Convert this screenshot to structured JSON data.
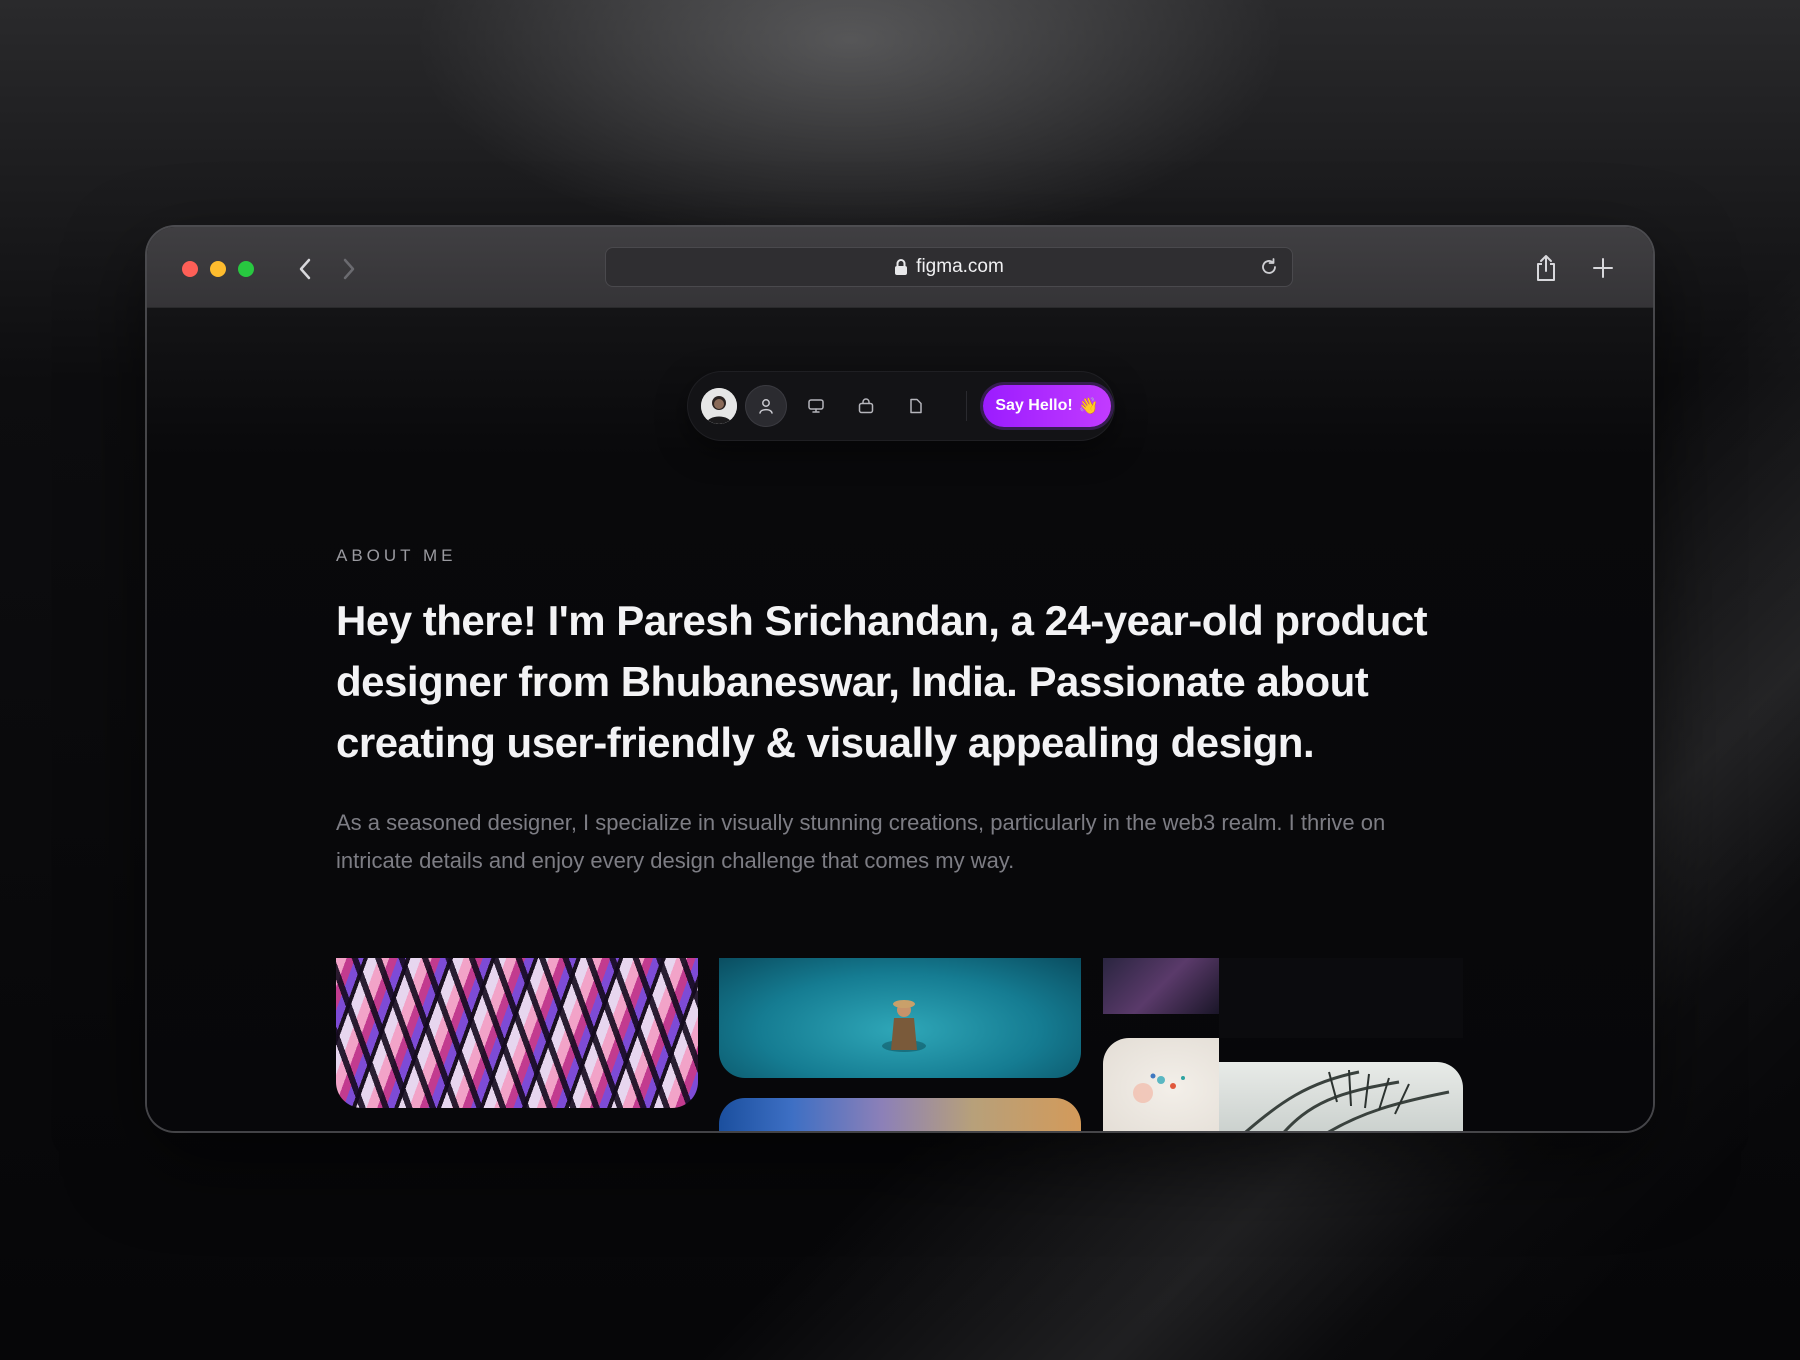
{
  "browser": {
    "url": "figma.com"
  },
  "nav": {
    "items": [
      "avatar",
      "about-person-icon",
      "projects-monitor-icon",
      "work-bag-icon",
      "resume-document-icon"
    ],
    "cta_label": "Say Hello!",
    "cta_emoji": "👋",
    "accent": "#a32bff"
  },
  "about": {
    "eyebrow": "ABOUT ME",
    "headline": "Hey there! I'm Paresh Srichandan, a 24-year-old product designer from Bhubaneswar, India. Passionate about creating user-friendly & visually appealing design.",
    "body": "As a seasoned designer, I specialize in visually stunning creations, particularly in the web3 realm. I thrive on intricate details and enjoy every design challenge that comes my way."
  },
  "colors": {
    "background": "#07070a",
    "traffic_red": "#fe5f57",
    "traffic_yellow": "#febc2e",
    "traffic_green": "#28c840"
  }
}
